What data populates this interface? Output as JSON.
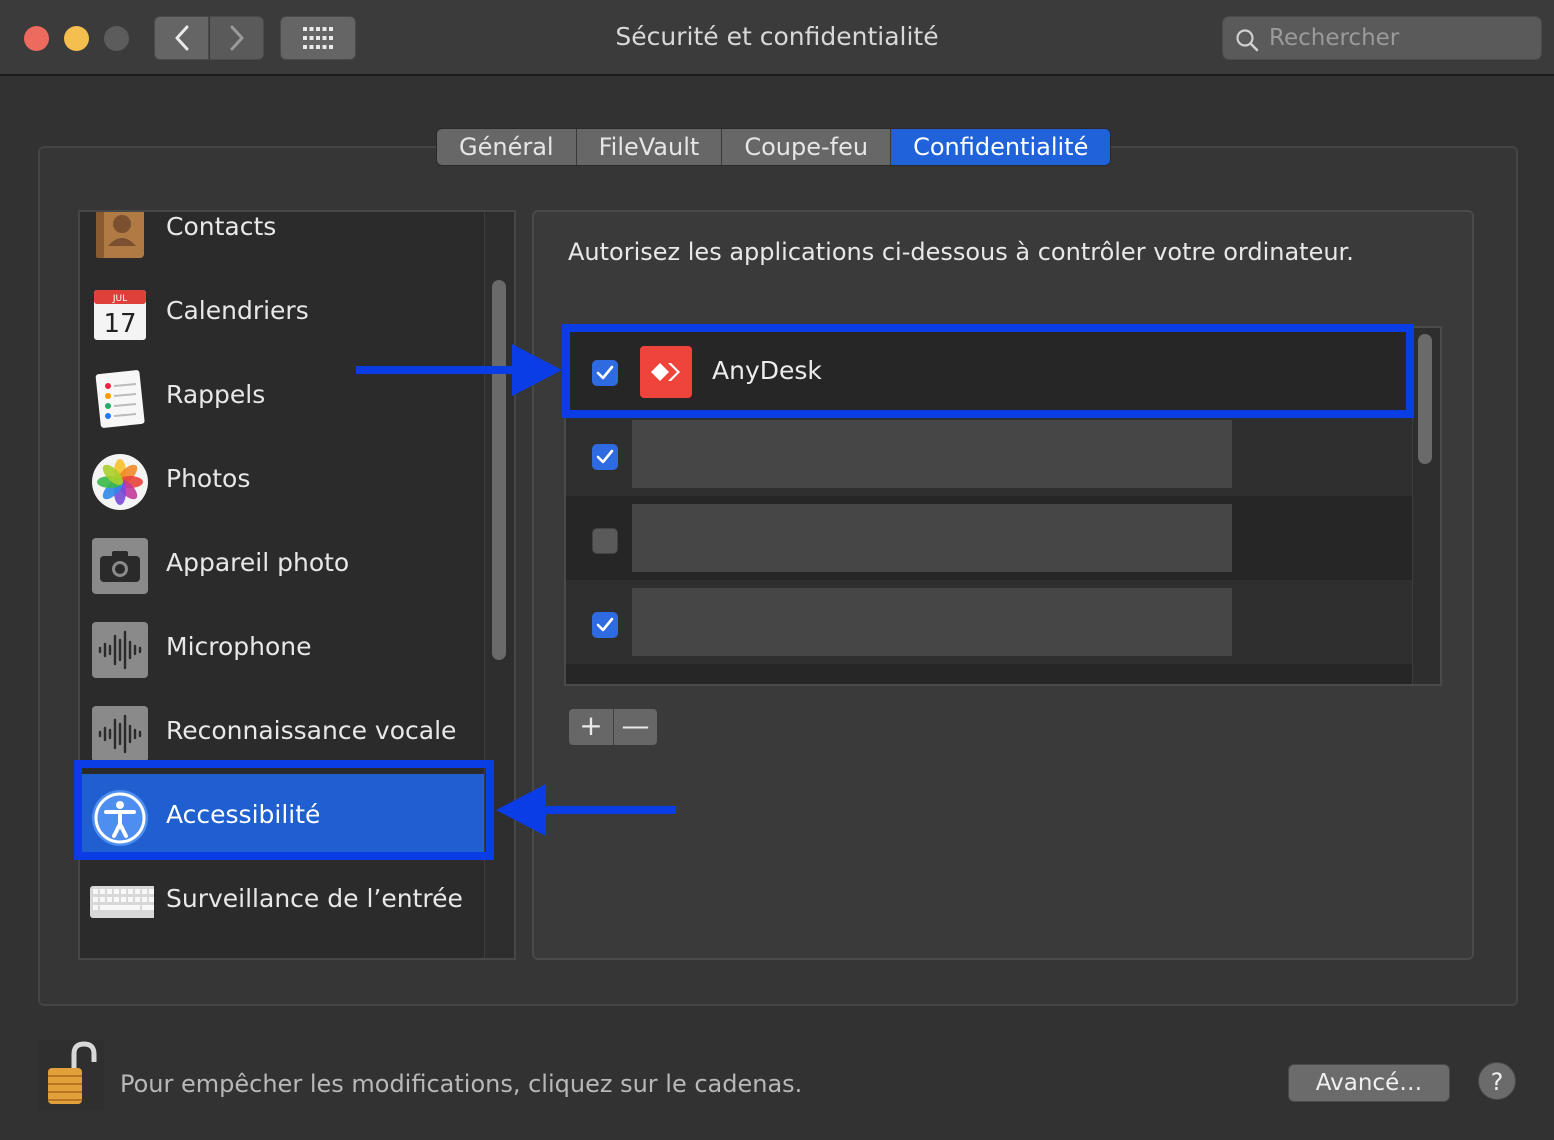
{
  "window": {
    "title": "Sécurité et confidentialité"
  },
  "search": {
    "placeholder": "Rechercher"
  },
  "tabs": [
    {
      "label": "Général",
      "active": false
    },
    {
      "label": "FileVault",
      "active": false
    },
    {
      "label": "Coupe-feu",
      "active": false
    },
    {
      "label": "Confidentialité",
      "active": true
    }
  ],
  "sidebar": {
    "items": [
      {
        "label": "Contacts",
        "icon": "contacts-icon"
      },
      {
        "label": "Calendriers",
        "icon": "calendar-icon",
        "icon_month": "JUL",
        "icon_day": "17"
      },
      {
        "label": "Rappels",
        "icon": "reminders-icon"
      },
      {
        "label": "Photos",
        "icon": "photos-icon"
      },
      {
        "label": "Appareil photo",
        "icon": "camera-icon"
      },
      {
        "label": "Microphone",
        "icon": "microphone-icon"
      },
      {
        "label": "Reconnaissance vocale",
        "icon": "speech-recognition-icon"
      },
      {
        "label": "Accessibilité",
        "icon": "accessibility-icon",
        "selected": true
      },
      {
        "label": "Surveillance de l’entrée",
        "icon": "keyboard-icon"
      }
    ]
  },
  "main": {
    "description": "Autorisez les applications ci-dessous à contrôler votre ordinateur.",
    "apps": [
      {
        "name": "AnyDesk",
        "checked": true,
        "icon": "anydesk-icon"
      },
      {
        "name": "",
        "checked": true
      },
      {
        "name": "",
        "checked": false
      },
      {
        "name": "",
        "checked": true
      }
    ],
    "add_label": "+",
    "remove_label": "—"
  },
  "footer": {
    "lock_text": "Pour empêcher les modifications, cliquez sur le cadenas.",
    "advanced_label": "Avancé…",
    "help_label": "?"
  },
  "colors": {
    "accent": "#1f62d9",
    "highlight": "#0a3de6",
    "anydesk": "#ef443b"
  }
}
